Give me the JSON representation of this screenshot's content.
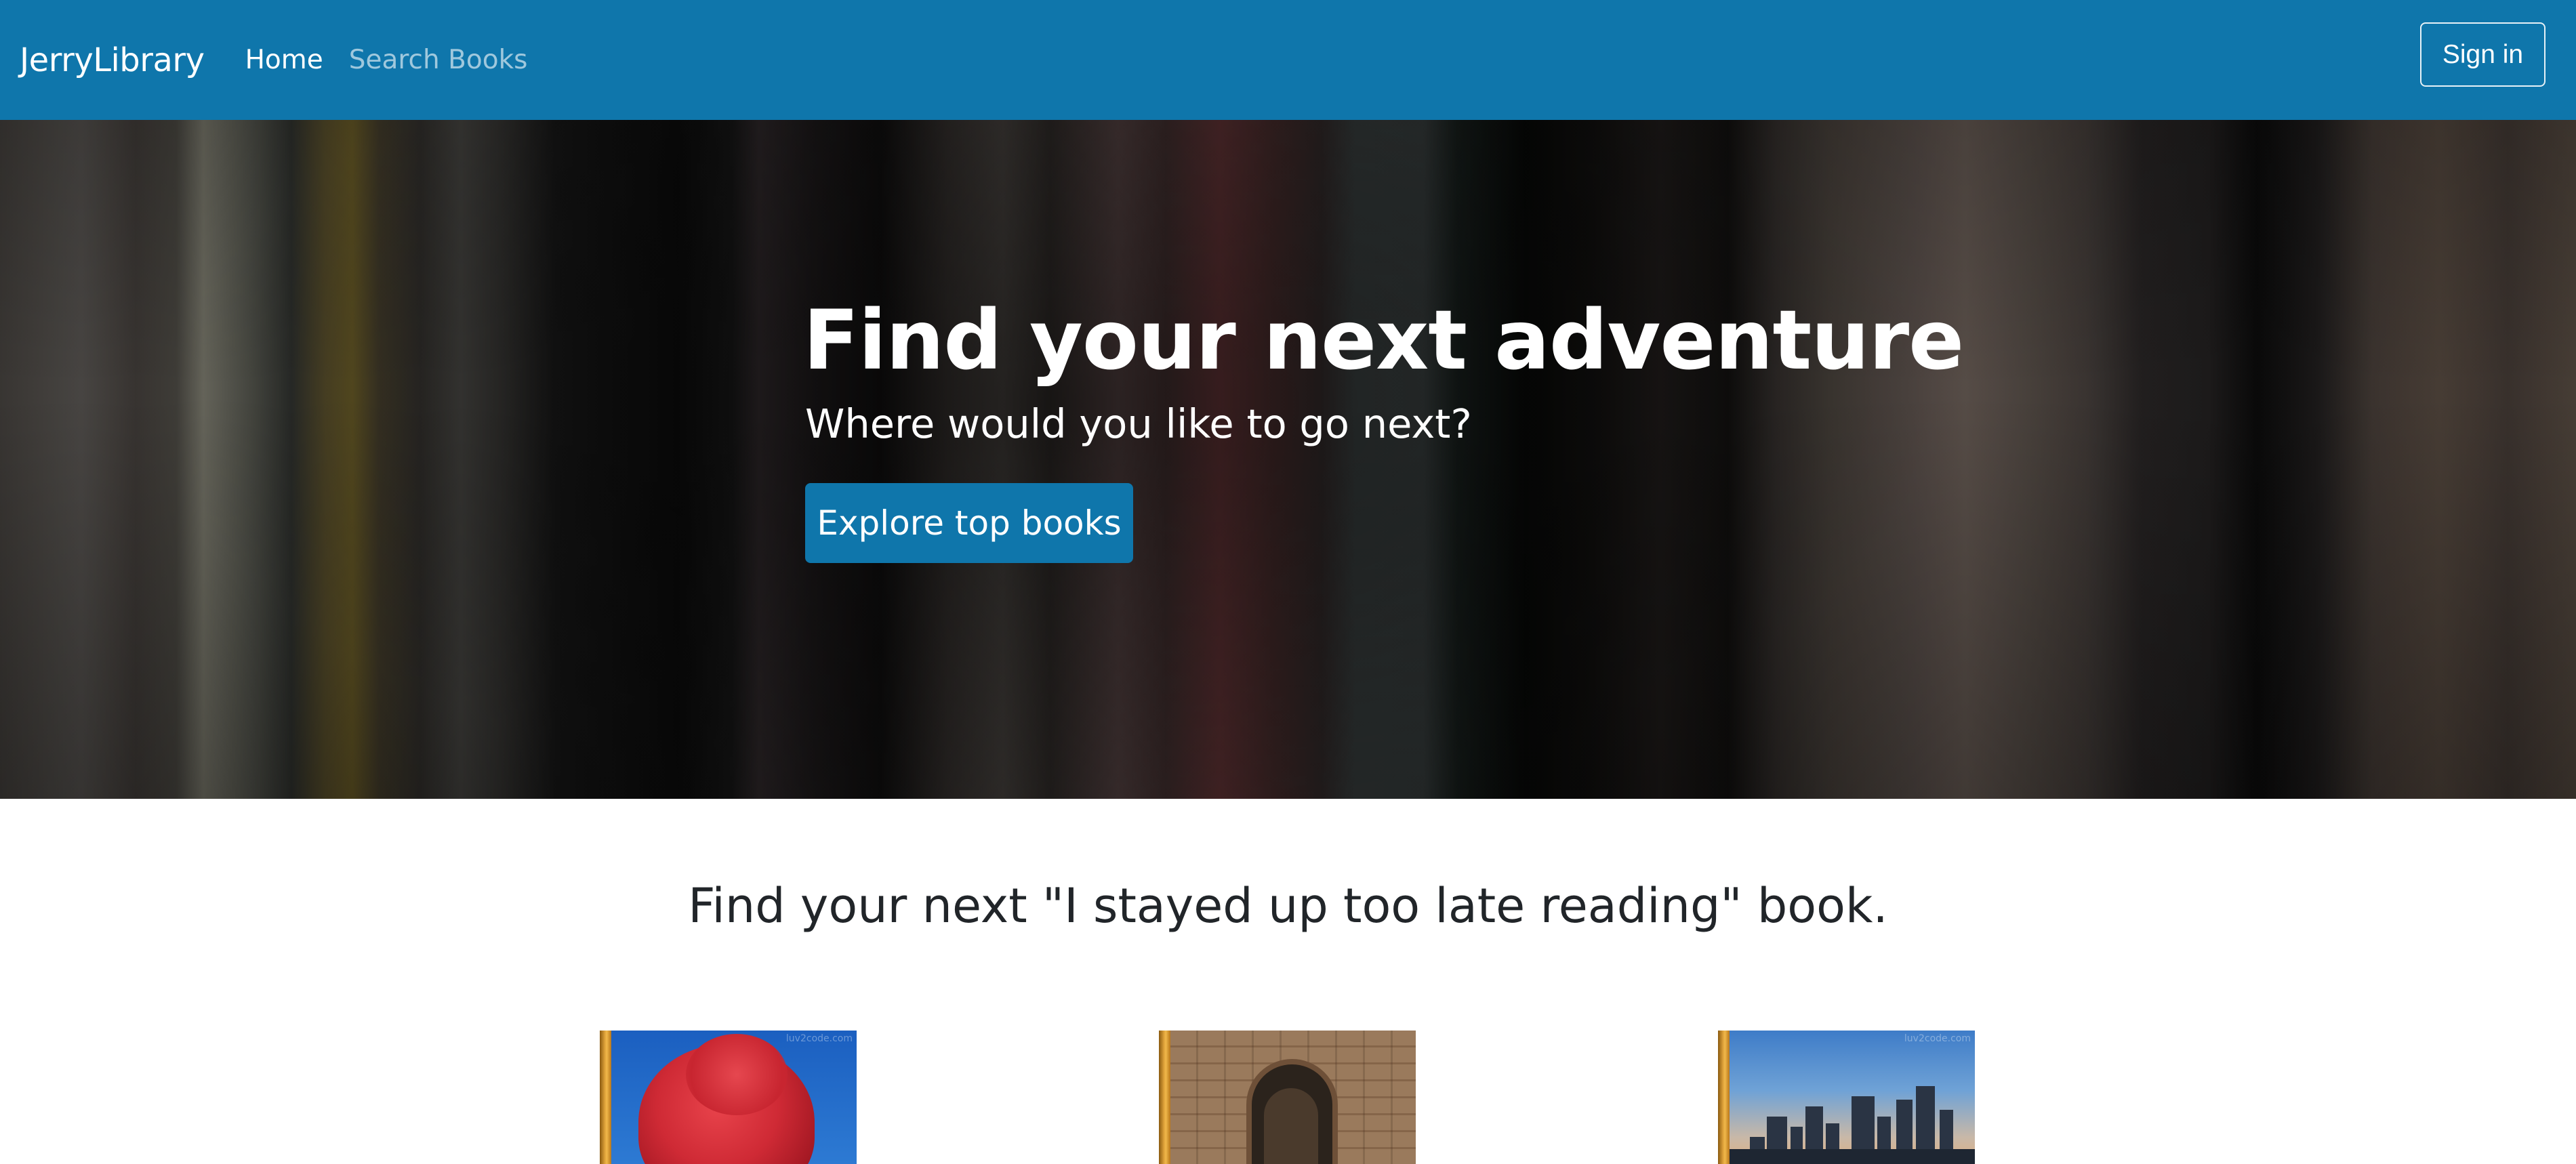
{
  "navbar": {
    "brand": "JerryLibrary",
    "links": [
      {
        "label": "Home",
        "active": true
      },
      {
        "label": "Search Books",
        "active": false
      }
    ],
    "signin_label": "Sign in"
  },
  "hero": {
    "title": "Find your next adventure",
    "subtitle": "Where would you like to go next?",
    "cta_label": "Explore top books"
  },
  "main": {
    "section_title": "Find your next \"I stayed up too late reading\" book.",
    "books": [
      {
        "cover": "red-tree-cover",
        "watermark": "luv2code.com"
      },
      {
        "cover": "stone-arch-cover"
      },
      {
        "cover": "city-skyline-cover",
        "watermark": "luv2code.com"
      }
    ]
  },
  "colors": {
    "primary": "#0f76ab",
    "text_dark": "#212529",
    "white": "#ffffff"
  }
}
